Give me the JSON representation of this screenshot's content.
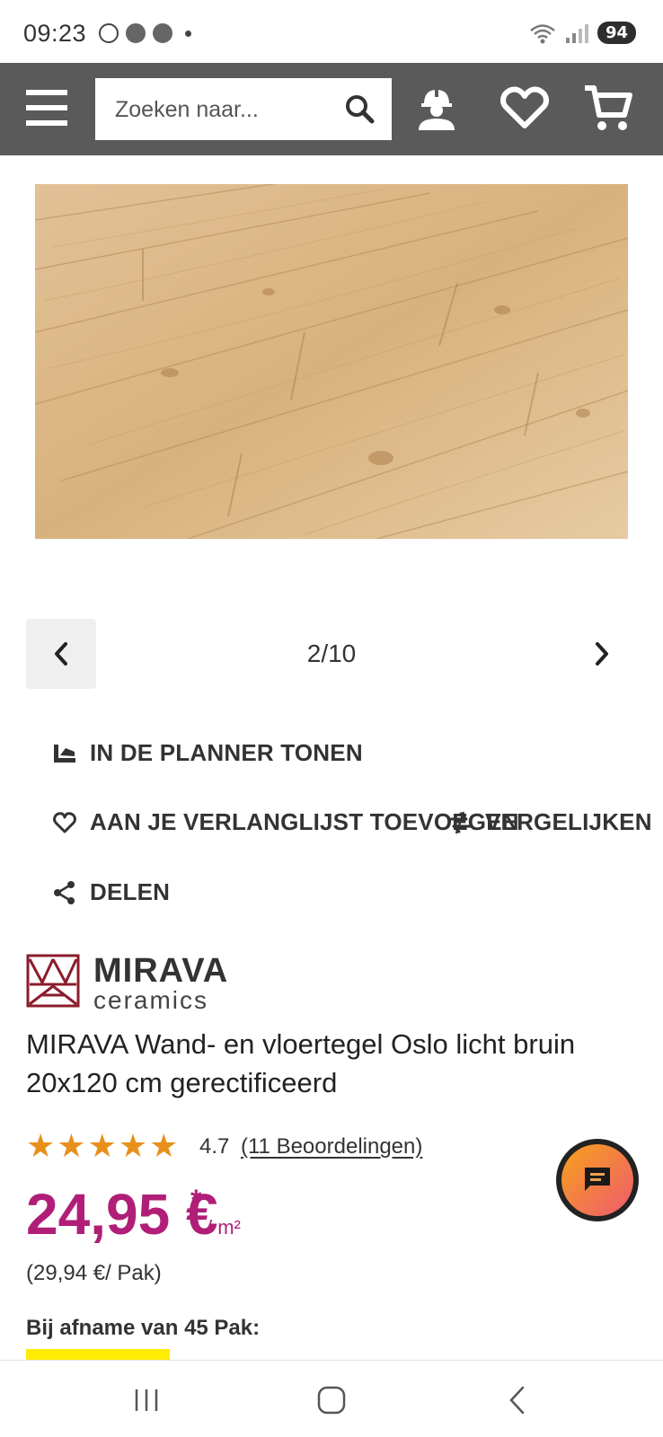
{
  "status_bar": {
    "time": "09:23",
    "battery": "94",
    "icons": [
      "browser-icon",
      "record-icon",
      "messenger-icon",
      "dot-icon",
      "wifi-icon",
      "signal-icon"
    ]
  },
  "header": {
    "search_placeholder": "Zoeken naar...",
    "icons": [
      "menu-icon",
      "search-icon",
      "account-icon",
      "wishlist-icon",
      "cart-icon"
    ],
    "background_color": "#5a5a5a"
  },
  "gallery": {
    "counter": "2/10",
    "current": 2,
    "total": 10
  },
  "actions": {
    "planner": "IN DE PLANNER TONEN",
    "wishlist": "AAN JE VERLANGLIJST TOEVOEGEN",
    "compare": "VERGELIJKEN",
    "share": "DELEN"
  },
  "brand": {
    "name": "MIRAVA",
    "sub": "ceramics",
    "color": "#8b1c2b"
  },
  "product": {
    "title": "MIRAVA Wand- en vloertegel Oslo licht bruin 20x120 cm gerectificeerd",
    "rating_value": "4.7",
    "rating_stars": 4.7,
    "rating_max": 5,
    "reviews_link": "(11 Beoordelingen)",
    "price": "24,95 €",
    "price_asterisk": "*",
    "price_unit": "/ m²",
    "price_per_pak": "(29,94 €/ Pak)",
    "bulk_label": "Bij afname van 45 Pak:",
    "price_color": "#b01e78",
    "star_color": "#e8901c"
  }
}
